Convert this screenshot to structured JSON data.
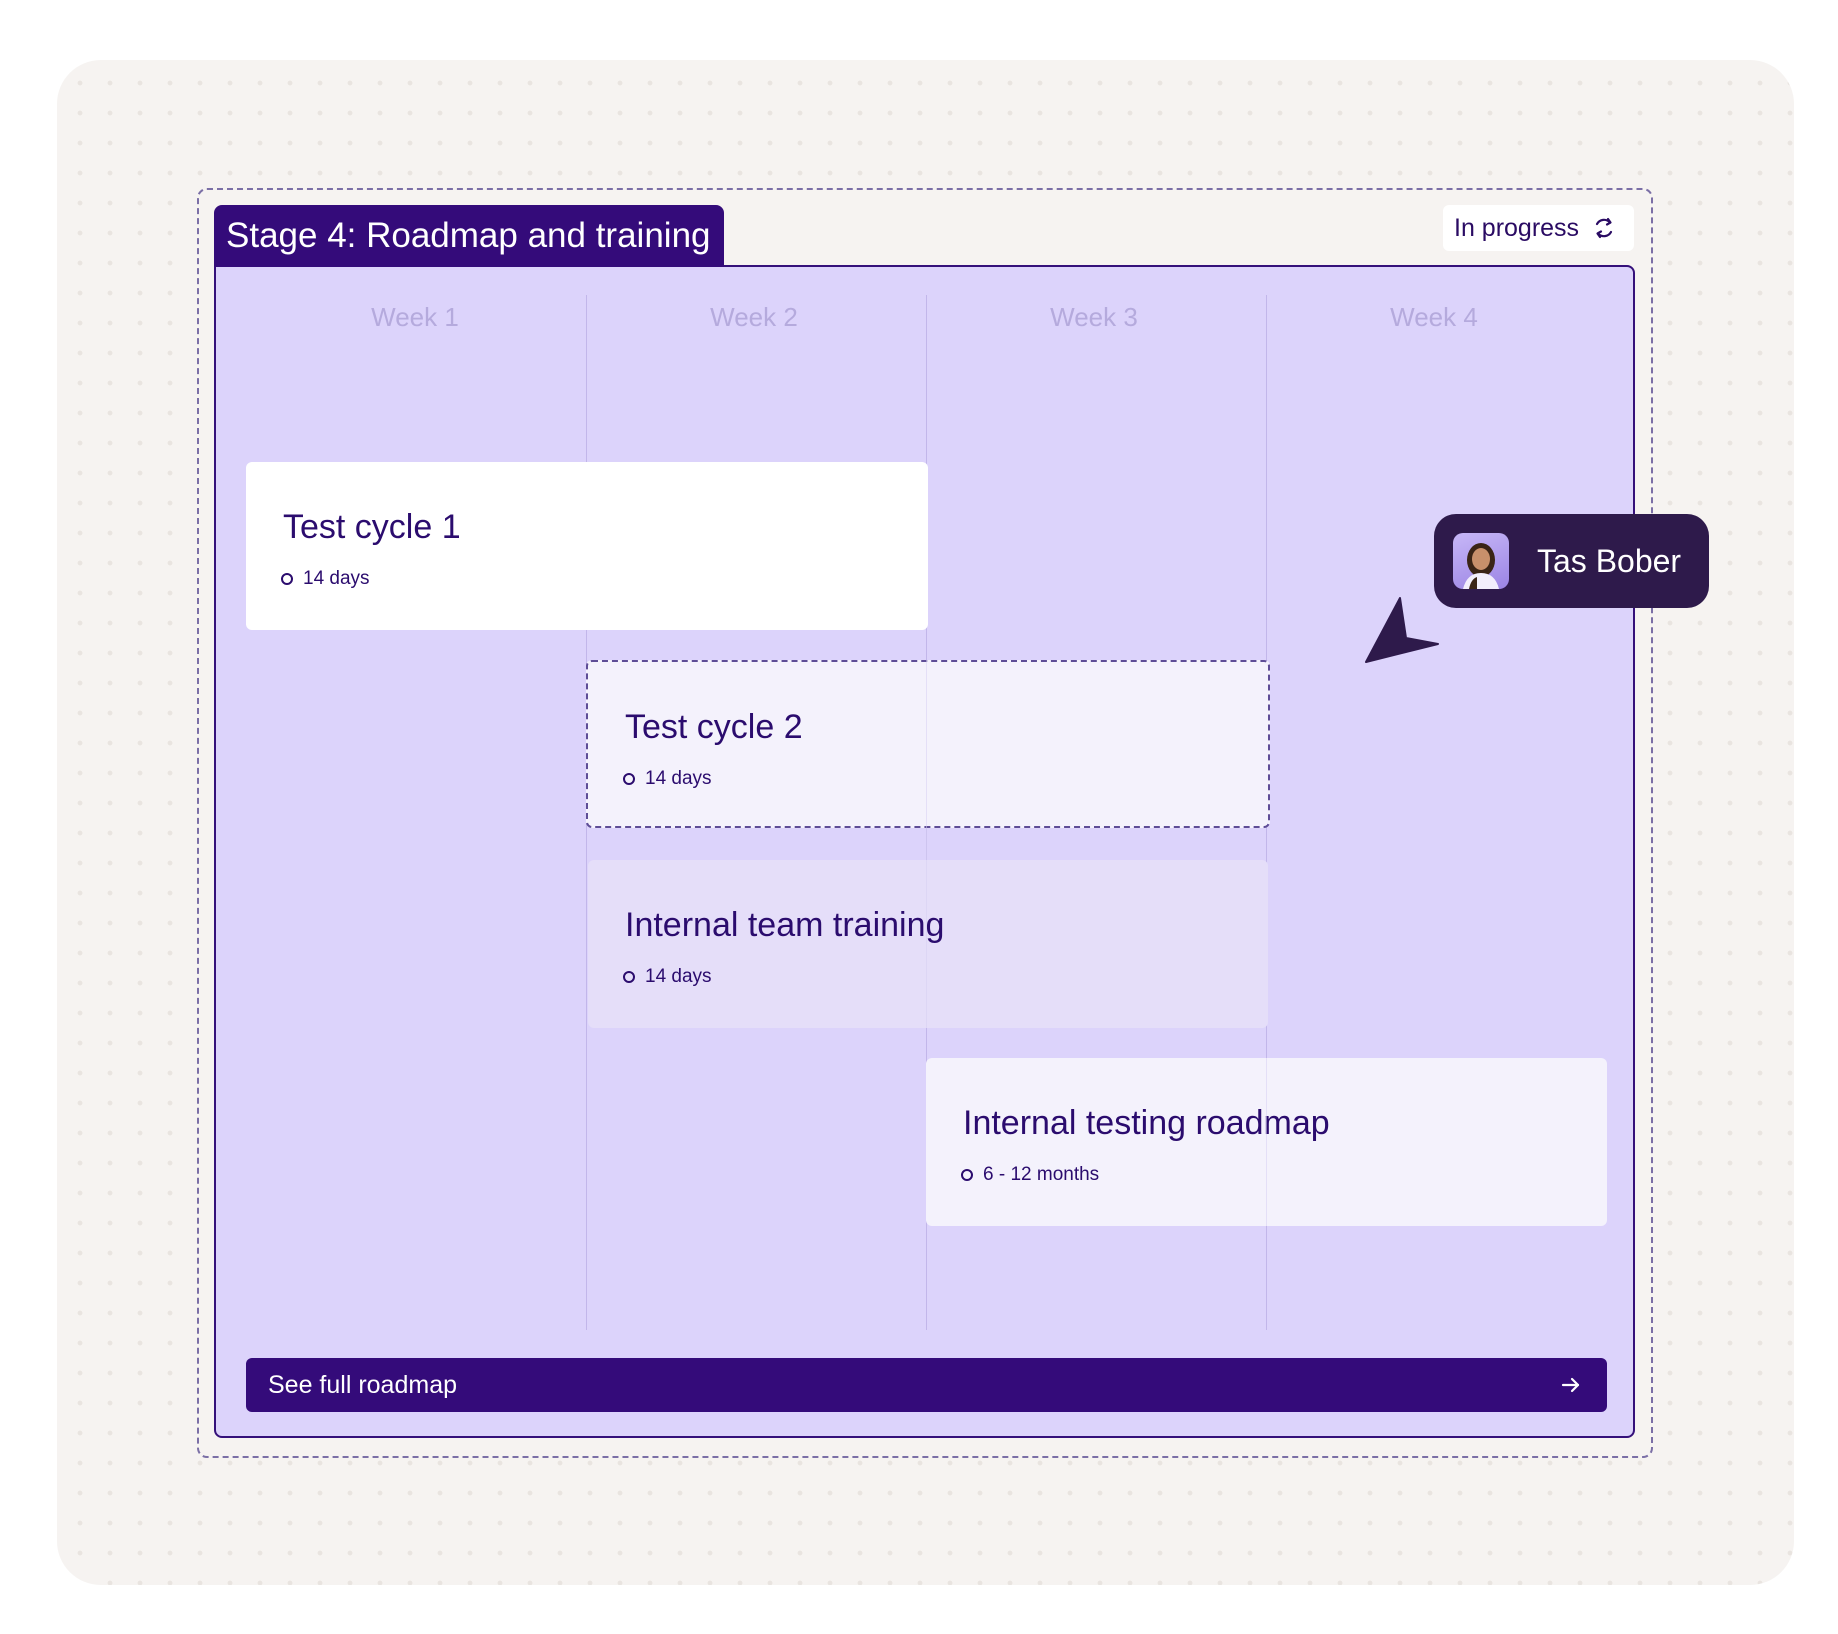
{
  "stage": {
    "title": "Stage 4: Roadmap and training",
    "status_label": "In progress",
    "status_icon": "refresh-icon"
  },
  "weeks": [
    "Week 1",
    "Week 2",
    "Week 3",
    "Week 4"
  ],
  "cards": [
    {
      "title": "Test cycle 1",
      "duration": "14 days"
    },
    {
      "title": "Test cycle 2",
      "duration": "14 days"
    },
    {
      "title": "Internal team training",
      "duration": "14 days"
    },
    {
      "title": "Internal testing roadmap",
      "duration": "6 - 12 months"
    }
  ],
  "cta": {
    "label": "See full roadmap",
    "icon": "arrow-right-icon"
  },
  "collaborator": {
    "name": "Tas Bober",
    "avatar_icon": "avatar"
  },
  "colors": {
    "brand": "#340b7a",
    "panel": "#dcd3fb",
    "collaborator_chip": "#2e1a4b"
  }
}
